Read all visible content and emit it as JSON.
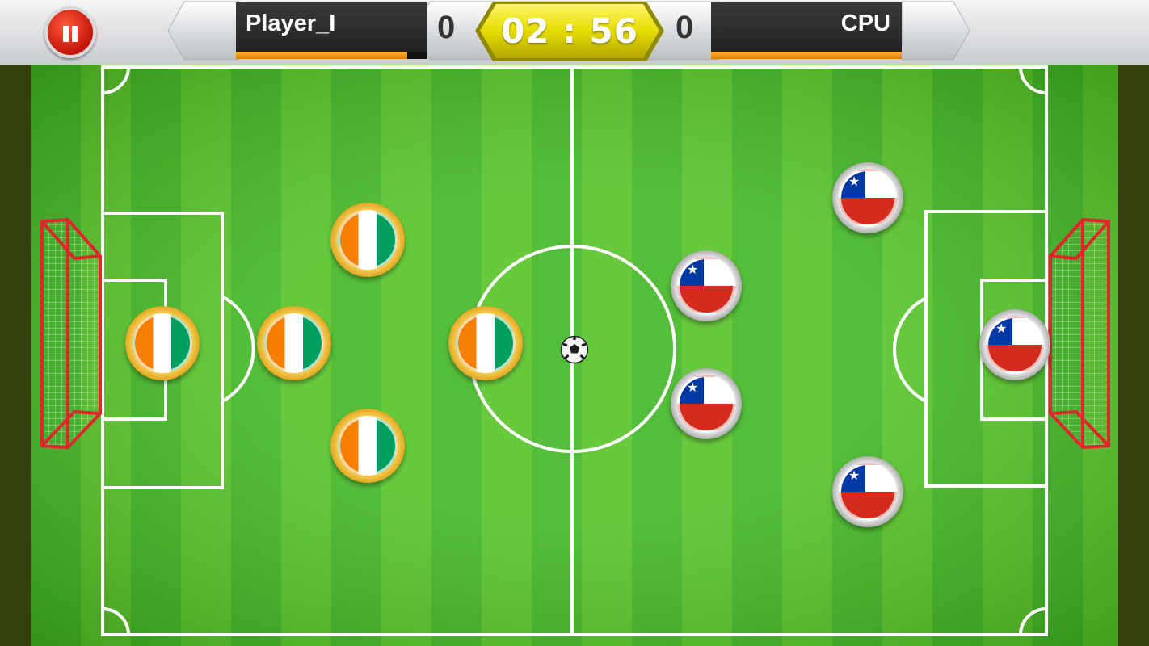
{
  "hud": {
    "pause_icon": "pause-icon",
    "player_name": "Player_I",
    "player_score": "0",
    "player_power": 0.9,
    "cpu_name": "CPU",
    "cpu_score": "0",
    "cpu_power": 1.0,
    "timer": "02 : 56"
  },
  "teams": {
    "player_flag": "Côte d'Ivoire",
    "cpu_flag": "Chile"
  },
  "colors": {
    "pitch_light": "#53c223",
    "pitch_dark": "#2fa61b",
    "timer_bg": "#e8e200",
    "pause_red": "#d4200c",
    "power_orange": "#f39a1a"
  },
  "icons": {
    "ball": "soccer-ball-icon",
    "goal_left": "goal-net-icon",
    "goal_right": "goal-net-icon"
  }
}
